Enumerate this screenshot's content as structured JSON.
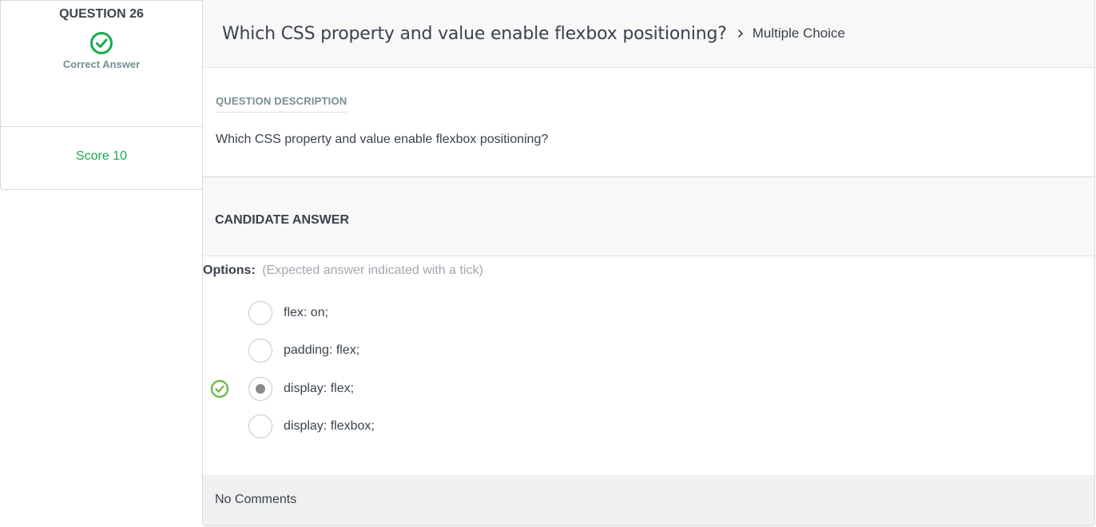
{
  "question": {
    "number_label": "QUESTION 26",
    "status_label": "Correct Answer",
    "status_icon": "check-circle-icon",
    "status_color": "#1ba94c",
    "score_label": "Score 10"
  },
  "header": {
    "title": "Which CSS property and value enable flexbox positioning?",
    "separator_icon": "chevron-right-icon",
    "question_type": "Multiple Choice"
  },
  "description": {
    "label": "QUESTION DESCRIPTION",
    "text": "Which CSS property and value enable flexbox positioning?"
  },
  "candidate_answer": {
    "heading": "CANDIDATE ANSWER",
    "options_label": "Options:",
    "options_hint": "(Expected answer indicated with a tick)",
    "options": [
      {
        "text": "flex: on;",
        "selected": false,
        "expected": false
      },
      {
        "text": "padding: flex;",
        "selected": false,
        "expected": false
      },
      {
        "text": "display: flex;",
        "selected": true,
        "expected": true
      },
      {
        "text": "display: flexbox;",
        "selected": false,
        "expected": false
      }
    ]
  },
  "comments": {
    "text": "No Comments"
  }
}
